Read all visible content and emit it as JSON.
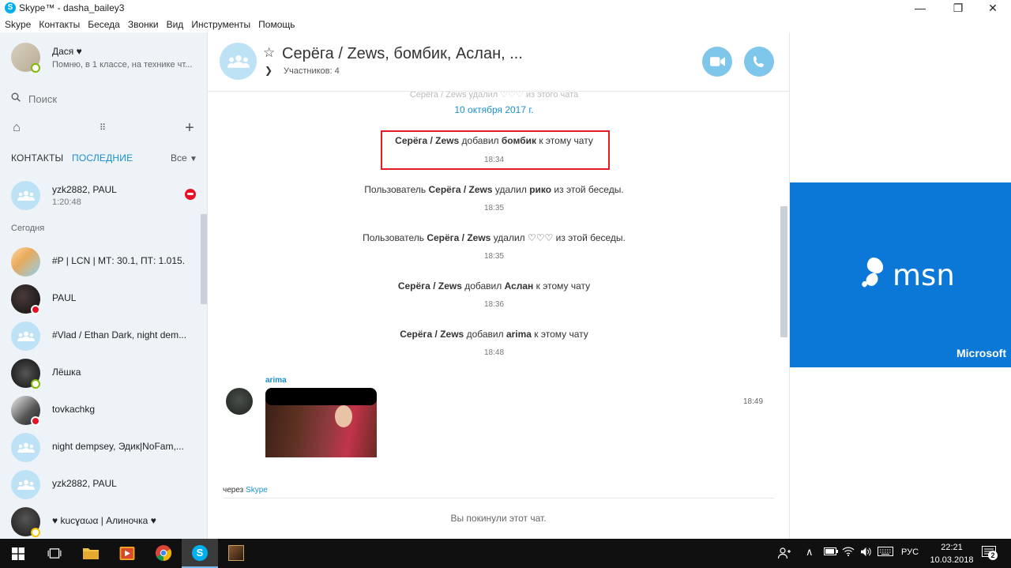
{
  "window": {
    "title": "Skype™ - dasha_bailey3",
    "minimize": "—",
    "maximize": "❐",
    "close": "✕"
  },
  "menu": [
    "Skype",
    "Контакты",
    "Беседа",
    "Звонки",
    "Вид",
    "Инструменты",
    "Помощь"
  ],
  "profile": {
    "name": "Дася ♥",
    "mood": "Помню, в 1 классе, на технике чт..."
  },
  "search": {
    "placeholder": "Поиск"
  },
  "tabs": {
    "contacts": "КОНТАКТЫ",
    "recent": "ПОСЛЕДНИЕ",
    "filter": "Все"
  },
  "recent_top": {
    "name": "yzk2882, PAUL",
    "sub": "1:20:48"
  },
  "section_today": "Сегодня",
  "contacts": [
    {
      "name": "#P | LCN | МТ: 30.1, ПТ: 1.015.",
      "type": "photo",
      "presence": "none"
    },
    {
      "name": "PAUL",
      "type": "photo",
      "presence": "dnd"
    },
    {
      "name": "#Vlad / Ethan Dark, night dem...",
      "type": "group",
      "presence": "none"
    },
    {
      "name": "Лёшка",
      "type": "photo",
      "presence": "online"
    },
    {
      "name": "tovkachkg",
      "type": "photo",
      "presence": "dnd"
    },
    {
      "name": "night dempsey, Эдик|NoFam,...",
      "type": "group",
      "presence": "none"
    },
    {
      "name": "yzk2882, PAUL",
      "type": "group",
      "presence": "none"
    },
    {
      "name": "♥ kucɣαωα | Алиночка ♥",
      "type": "photo",
      "presence": "away"
    }
  ],
  "chat": {
    "title": "Серёга / Zews, бомбик, Аслан, ...",
    "members": "Участников: 4",
    "faded_top": "Серёга / Zews удалил ♡♡♡ из этого чата",
    "date": "10 октября 2017 г.",
    "events": [
      {
        "pre": "",
        "actor": "Серёга / Zews",
        "mid": " добавил ",
        "target": "бомбик",
        "post": " к этому чату",
        "time": "18:34"
      },
      {
        "pre": "Пользователь ",
        "actor": "Серёга / Zews",
        "mid": " удалил ",
        "target": "рико",
        "post": " из этой беседы.",
        "time": "18:35"
      },
      {
        "pre": "Пользователь ",
        "actor": "Серёга / Zews",
        "mid": " удалил ♡♡♡",
        "target": "",
        "post": " из этой беседы.",
        "time": "18:35"
      },
      {
        "pre": "",
        "actor": "Серёга / Zews",
        "mid": " добавил ",
        "target": "Аслан",
        "post": " к этому чату",
        "time": "18:36"
      },
      {
        "pre": "",
        "actor": "Серёга / Zews",
        "mid": " добавил ",
        "target": "arima",
        "post": " к этому чату",
        "time": "18:48"
      }
    ],
    "message": {
      "author": "arima",
      "time": "18:49"
    },
    "via_prefix": "через ",
    "via_link": "Skype",
    "left_notice": "Вы покинули этот чат."
  },
  "ad": {
    "brand": "msn",
    "company": "Microsoft"
  },
  "taskbar": {
    "lang": "РУС",
    "time": "22:21",
    "date": "10.03.2018",
    "notifications": "2"
  },
  "colors": {
    "accent": "#1b8fd0",
    "skype": "#00aff0",
    "msn": "#0b78d7",
    "highlight": "#e31b23"
  }
}
